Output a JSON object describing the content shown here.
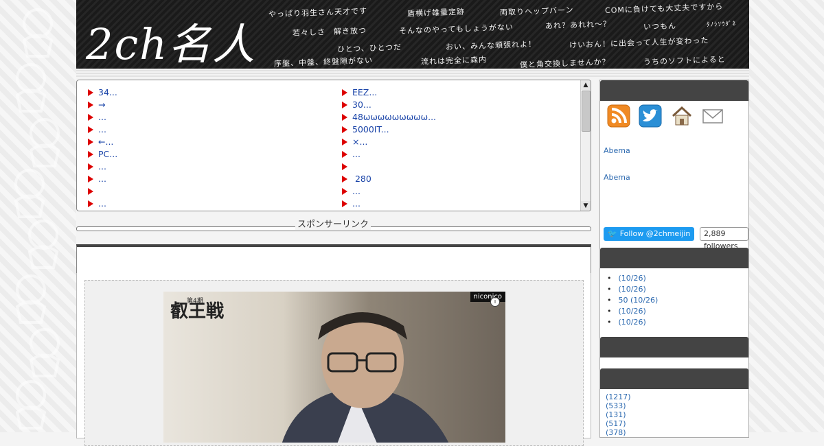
{
  "header": {
    "logo": "2ch名人",
    "phrases": [
      "やっぱり羽生さん天才です",
      "盾横げ雄量定跡",
      "両取りヘップバーン",
      "COMに負けても大丈夫ですから",
      "若々しさ　解き放つ",
      "そんなのやってもしょうがない",
      "あれ？あれれ～？",
      "いつもん",
      "ﾀﾉｼｿｳﾀﾞﾈ",
      "ひとつ、ひとつだ",
      "おい、みんな頑張れよ！",
      "けいおん！に出会って人生が変わった",
      "序盤、中盤、終盤隙がない",
      "流れは完全に森内",
      "僕と角交換しませんか？",
      "うちのソフトによると"
    ]
  },
  "news": {
    "col1": [
      "34...",
      "→",
      "...",
      "...",
      "←...",
      "PC...",
      "...",
      "...",
      "",
      "..."
    ],
    "col2": [
      "EEZ...",
      "30...",
      "48ωωωωωωωωω...",
      "5000IT...",
      "×...",
      "...",
      "",
      " 280",
      "...",
      "..."
    ],
    "scroll_up": "▲",
    "scroll_down": "▼"
  },
  "sponsor": {
    "label": "スポンサーリンク"
  },
  "video": {
    "logo": "叡王戦",
    "small": "第4期",
    "badge": "niconico",
    "info": "i"
  },
  "sidebar": {
    "abema1": "Abema",
    "abema2": "Abema",
    "follow_label": "Follow @2chmeijin",
    "followers": "2,889 followers",
    "recent": [
      "(10/26)",
      "(10/26)",
      "50 (10/26)",
      "(10/26)",
      "(10/26)"
    ],
    "recent_bullet": "•",
    "categories": [
      "(1217)",
      "(533)",
      "(131)",
      "(517)",
      "(378)"
    ]
  },
  "colors": {
    "accent_link": "#1a44a8",
    "arrow_red": "#dd0000",
    "twitter_blue": "#1d9bf0",
    "side_head": "#444444"
  },
  "icons": [
    "rss-icon",
    "twitter-icon",
    "home-icon",
    "mail-icon"
  ]
}
